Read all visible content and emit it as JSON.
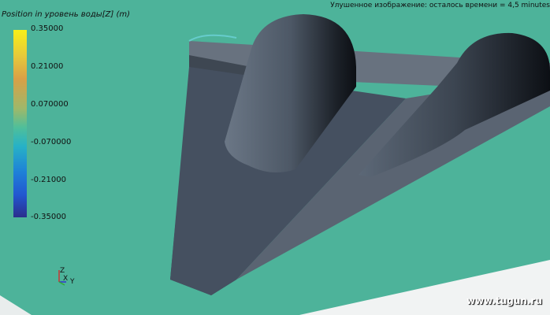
{
  "legend": {
    "title": "Position in уровень воды[Z] (m)",
    "ticks": [
      "0.35000",
      "0.21000",
      "0.070000",
      "-0.070000",
      "-0.21000",
      "-0.35000"
    ]
  },
  "status_text": "Улушенное изображение: осталось времени = 4,5 minutes",
  "axes": {
    "z": "Z",
    "x": "X",
    "y": "Y"
  },
  "watermark": "www.tugun.ru",
  "colors": {
    "background": "#4db39a",
    "hull": "#4a5563",
    "colorbar_top": "#f7ef18",
    "colorbar_bottom": "#2b2f8c"
  }
}
